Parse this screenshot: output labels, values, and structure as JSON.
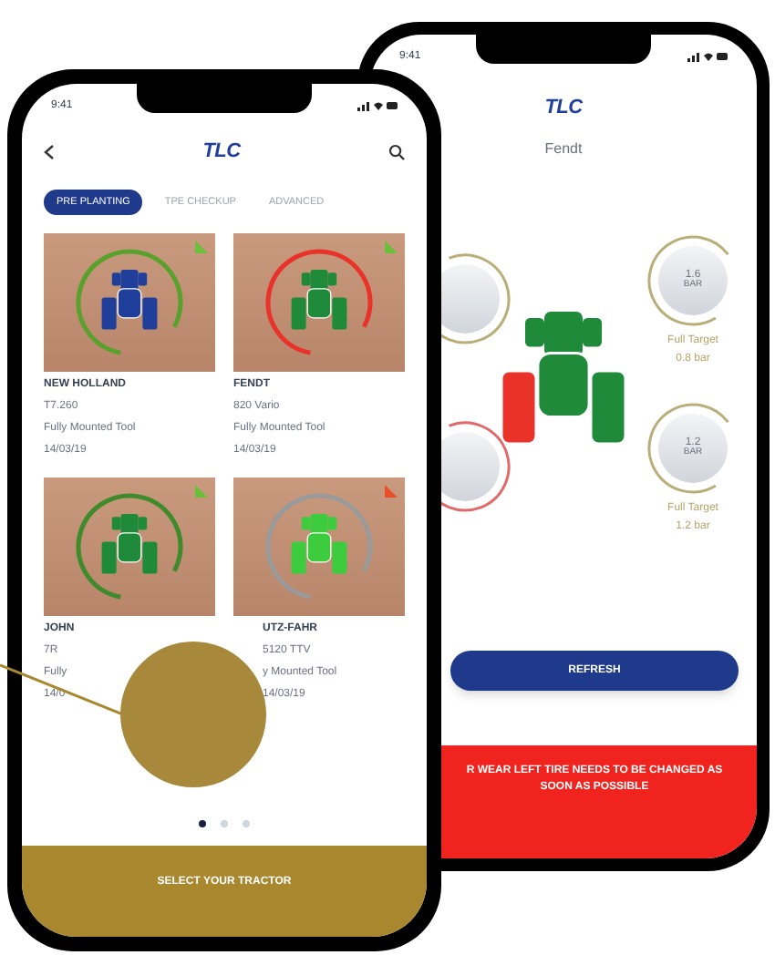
{
  "back_phone": {
    "time": "9:41",
    "logo": "TLC",
    "title": "Fendt",
    "gauges": [
      {
        "kind": "partial",
        "color": "#b9ad78"
      },
      {
        "kind": "full",
        "color": "#b9ad78",
        "value": "1.6",
        "unit": "BAR",
        "label": "Full Target",
        "target": "0.8 bar"
      },
      {
        "kind": "partial",
        "color": "#e06a6a"
      },
      {
        "kind": "full",
        "color": "#b9ad78",
        "value": "1.2",
        "unit": "BAR",
        "label": "Full Target",
        "target": "1.2 bar"
      }
    ],
    "tires": [
      {
        "color": "#1e8a3a"
      },
      {
        "color": "#1e8a3a"
      },
      {
        "color": "#e8322a"
      },
      {
        "color": "#1e8a3a"
      }
    ],
    "button": "REFRESH",
    "alert": "R WEAR LEFT TIRE NEEDS TO BE CHANGED AS SOON AS POSSIBLE"
  },
  "front_phone": {
    "time": "9:41",
    "logo": "TLC",
    "tabs": [
      {
        "label": "PRE PLANTING",
        "selected": true
      },
      {
        "label": "TPE CHECKUP",
        "selected": false
      },
      {
        "label": "ADVANCED",
        "selected": false
      }
    ],
    "cards": [
      {
        "name": "NEW HOLLAND",
        "model": "T7.260",
        "tool": "Fully Mounted Tool",
        "date": "14/03/19",
        "tractor": {
          "color": "#1f3f9a"
        },
        "ring": {
          "color": "#5aa02c"
        },
        "flag": {
          "color": "#6bbf3a"
        }
      },
      {
        "name": "FENDT",
        "model": "820 Vario",
        "tool": "Fully Mounted Tool",
        "date": "14/03/19",
        "tractor": {
          "color": "#1e8a3a"
        },
        "ring": {
          "color": "#e8322a"
        },
        "flag": {
          "color": "#6bbf3a"
        }
      },
      {
        "name": "JOHN",
        "model": "7R",
        "tool": "Fully",
        "date": "14/0",
        "tractor": {
          "color": "#1e8a3a"
        },
        "ring": {
          "color": "#3f8a2a"
        },
        "flag": {
          "color": "#6bbf3a"
        }
      },
      {
        "name": "UTZ-FAHR",
        "model": "5120 TTV",
        "tool": "y Mounted Tool",
        "date": "14/03/19",
        "tractor": {
          "color": "#3dcc3d"
        },
        "ring": {
          "color": "#9a9a9a"
        },
        "flag": {
          "color": "#e8502a"
        }
      }
    ],
    "pages": [
      {
        "selected": true
      },
      {
        "selected": false
      },
      {
        "selected": false
      }
    ],
    "bottom_button": "SELECT YOUR TRACTOR"
  }
}
